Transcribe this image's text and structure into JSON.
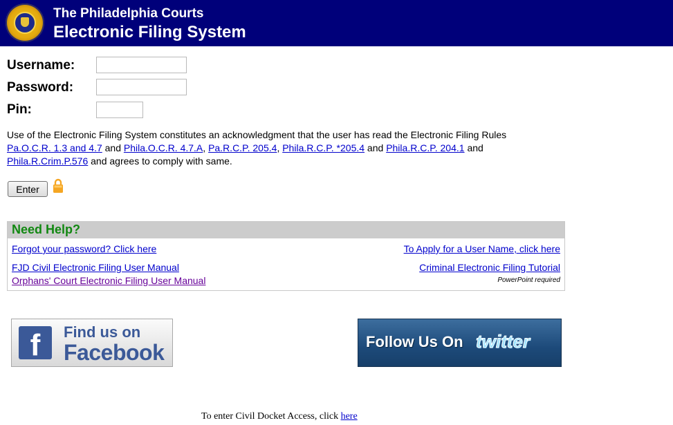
{
  "header": {
    "subtitle": "The Philadelphia Courts",
    "title": "Electronic Filing System"
  },
  "login": {
    "username_label": "Username:",
    "username_value": "",
    "password_label": "Password:",
    "password_value": "",
    "pin_label": "Pin:",
    "pin_value": "",
    "enter_label": "Enter"
  },
  "notice": {
    "text_1": "Use of the Electronic Filing System constitutes an acknowledgment that the user has read the Electronic Filing Rules",
    "link_1": "Pa.O.C.R. 1.3 and 4.7",
    "and_1": " and ",
    "link_2": "Phila.O.C.R. 4.7.A",
    "sep_1": ", ",
    "link_3": "Pa.R.C.P. 205.4",
    "sep_2": ", ",
    "link_4": "Phila.R.C.P. *205.4",
    "and_2": " and ",
    "link_5": "Phila.R.C.P. 204.1",
    "and_3": " and",
    "link_6": "Phila.R.Crim.P.576",
    "text_2": " and agrees to comply with same."
  },
  "help": {
    "title": "Need Help?",
    "forgot_password": "Forgot your password? Click here",
    "apply_username": "To Apply for a User Name, click here",
    "civil_manual": "FJD Civil Electronic Filing User Manual",
    "criminal_tutorial": "Criminal Electronic Filing Tutorial",
    "orphans_manual": "Orphans' Court Electronic Filing User Manual",
    "powerpoint_note": "PowerPoint required"
  },
  "social": {
    "facebook_line1": "Find us on",
    "facebook_line2": "Facebook",
    "twitter_text": "Follow Us On",
    "twitter_logo": "twitter"
  },
  "footer": {
    "docket_text": "To enter Civil Docket Access, click ",
    "docket_link": "here"
  },
  "colors": {
    "header_bg": "#00007a",
    "link": "#0000cc",
    "visited_link": "#660099",
    "help_title": "#118811",
    "help_header_bg": "#cccccc",
    "lock": "#f5a623"
  },
  "icons": {
    "seal": "seal-icon",
    "lock": "lock-icon",
    "facebook": "facebook-f-icon"
  }
}
